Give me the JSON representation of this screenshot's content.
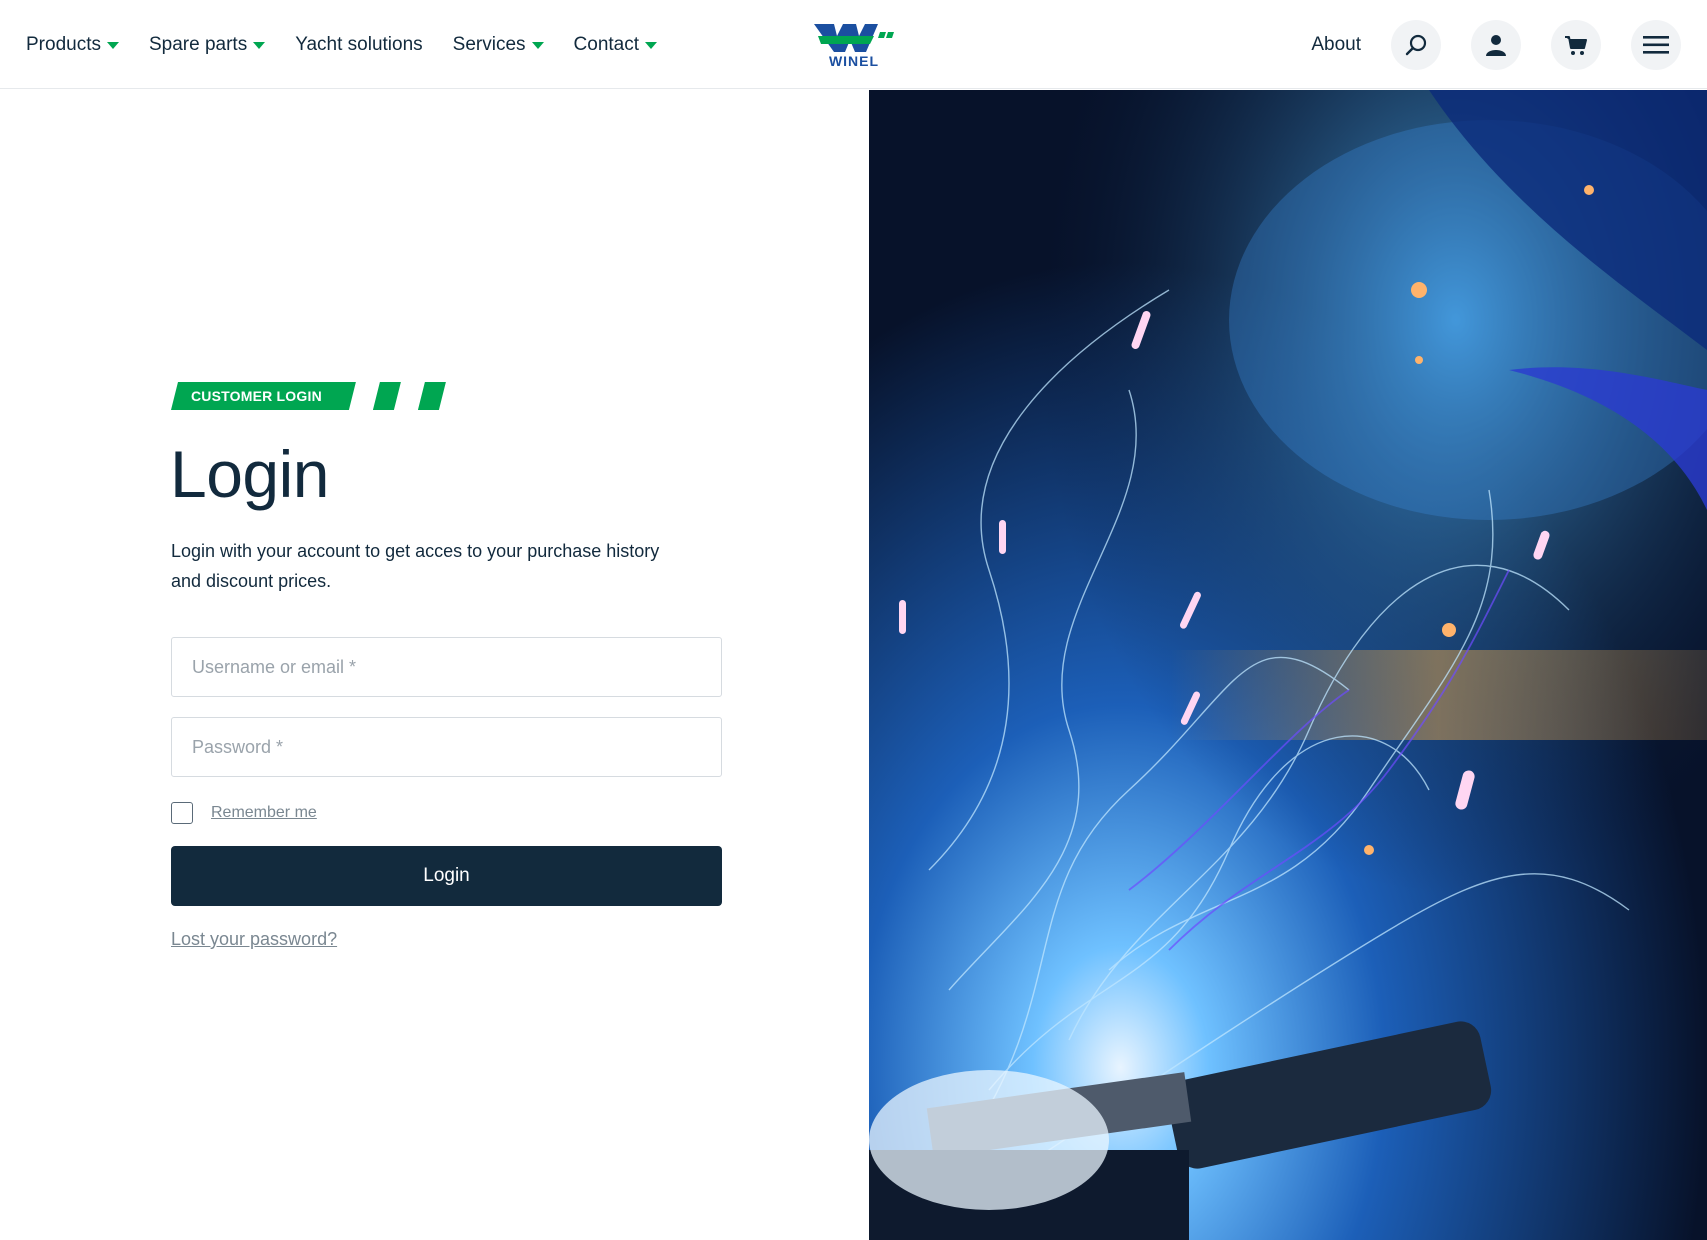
{
  "header": {
    "nav": [
      {
        "label": "Products"
      },
      {
        "label": "Spare parts"
      },
      {
        "label": "Yacht solutions"
      },
      {
        "label": "Services"
      },
      {
        "label": "Contact"
      }
    ],
    "logo_text": "WINEL",
    "about_label": "About",
    "icons": [
      "search-icon",
      "user-icon",
      "cart-icon",
      "menu-icon"
    ]
  },
  "login": {
    "tag": "CUSTOMER LOGIN",
    "title": "Login",
    "description": "Login with your account to get acces to your purchase history and discount prices.",
    "username_placeholder": "Username or email *",
    "password_placeholder": "Password *",
    "remember_label": "Remember me",
    "button_label": "Login",
    "lost_password": "Lost your password?"
  },
  "colors": {
    "brand_green": "#00a651",
    "brand_navy": "#122a3d",
    "logo_blue": "#1b4fa0"
  }
}
